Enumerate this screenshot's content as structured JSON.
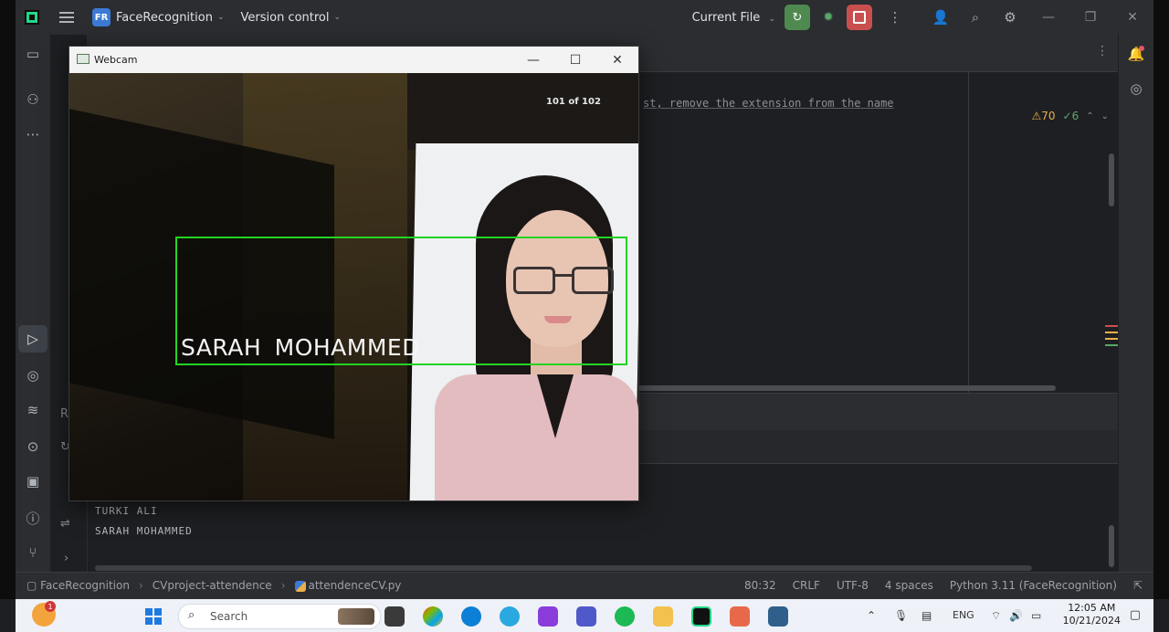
{
  "titlebar": {
    "project_badge": "FR",
    "project_name": "FaceRecognition",
    "version_control": "Version control",
    "run_config": "Current File"
  },
  "editor": {
    "code_fragment": "st, remove the extension from the name",
    "inspection_warnings": "70",
    "inspection_ok": "6"
  },
  "run_output": {
    "lines": [
      "TURKI ALI",
      "SARAH MOHAMMED"
    ]
  },
  "statusbar": {
    "crumbs": [
      "FaceRecognition",
      "CVproject-attendence",
      "attendenceCV.py"
    ],
    "position": "80:32",
    "line_sep": "CRLF",
    "encoding": "UTF-8",
    "indent": "4 spaces",
    "interpreter": "Python 3.11 (FaceRecognition)"
  },
  "webcam": {
    "title": "Webcam",
    "counter": "101 of 102",
    "face_label": "SARAH  MOHAMMED",
    "box_color": "#22d422"
  },
  "taskbar": {
    "weather_badge": "1",
    "search_label": "Search",
    "lang": "ENG",
    "time": "12:05 AM",
    "date": "10/21/2024"
  },
  "colors": {
    "ide_bg": "#1e1f22",
    "panel_bg": "#2b2d30",
    "run_green": "#4e8a4f",
    "stop_red": "#c94f4f"
  }
}
